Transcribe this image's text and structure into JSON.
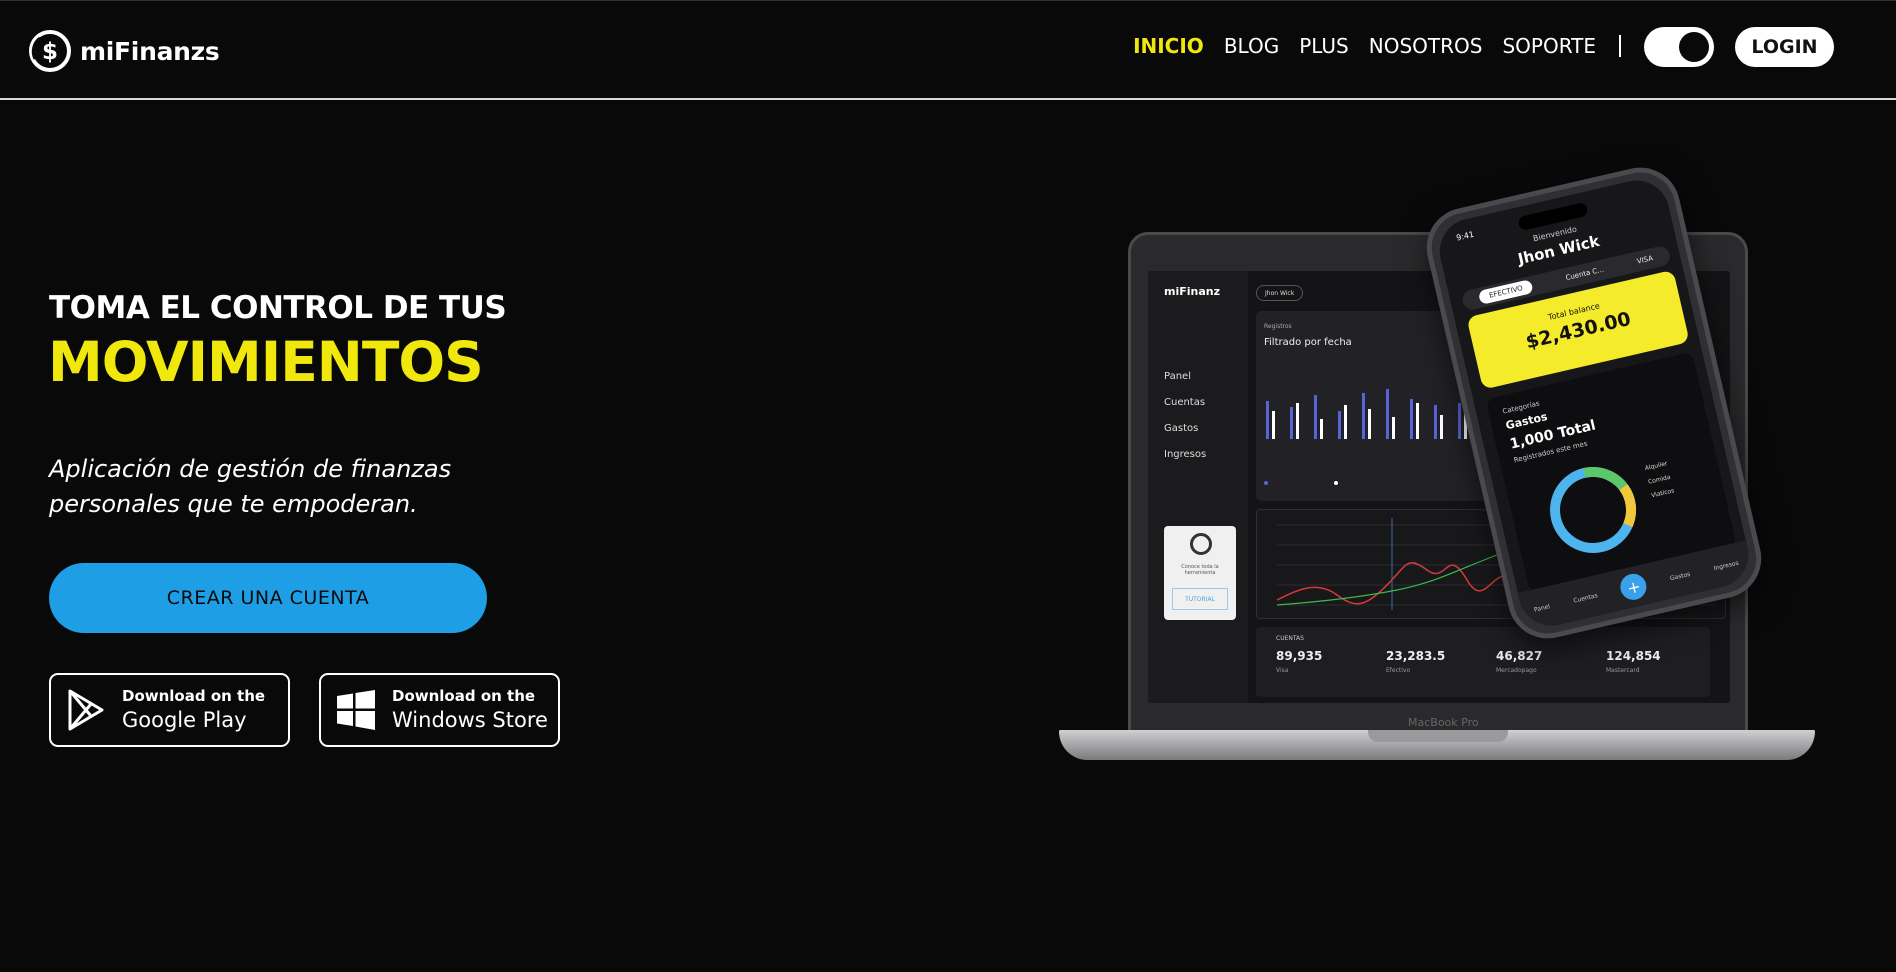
{
  "header": {
    "brand_name": "miFinanzs",
    "brand_icon": "dollar-coin-icon",
    "nav": [
      "INICIO",
      "BLOG",
      "PLUS",
      "NOSOTROS",
      "SOPORTE"
    ],
    "active_nav": "INICIO",
    "divider": "|",
    "login_label": "LOGIN",
    "theme_toggle_on": true
  },
  "hero": {
    "title_line1": "TOMA EL CONTROL DE TUS",
    "title_line2": "MOVIMIENTOS",
    "subtitle": "Aplicación de gestión de finanzas personales que te empoderan.",
    "cta_label": "CREAR UNA CUENTA",
    "stores": [
      {
        "icon": "google-play-icon",
        "small": "Download on the",
        "big": "Google Play"
      },
      {
        "icon": "windows-icon",
        "small": "Download on the",
        "big": "Windows Store"
      }
    ]
  },
  "mockup": {
    "laptop": {
      "brand": "miFinanz",
      "menu": [
        "Panel",
        "Cuentas",
        "Gastos",
        "Ingresos"
      ],
      "user": "Jhon Wick",
      "section_label": "Registros",
      "section_title": "Filtrado por fecha",
      "card_text": "Conoce toda la herramienta",
      "card_button": "TUTORIAL",
      "accounts_label": "CUENTAS",
      "accounts": [
        {
          "value": "89,935",
          "label": "Visa"
        },
        {
          "value": "23,283.5",
          "label": "Efectivo"
        },
        {
          "value": "46,827",
          "label": "Mercadopago"
        },
        {
          "value": "124,854",
          "label": "Mastercard"
        }
      ],
      "model_label": "MacBook Pro"
    },
    "phone": {
      "time": "9:41",
      "greeting": "Bienvenido",
      "user": "Jhon Wick",
      "tabs": [
        "EFECTIVO",
        "Cuenta C...",
        "VISA"
      ],
      "balance_label": "Total balance",
      "balance_value": "$2,430.00",
      "category_label": "Categorías",
      "category_title": "Gastos",
      "category_total": "1,000 Total",
      "category_sub": "Registrados este mes",
      "legend": [
        "Alquiler",
        "Comida",
        "Viaticos"
      ],
      "bottom_nav": [
        "Panel",
        "Cuentas",
        "Agregar",
        "Gastos",
        "Ingresos"
      ]
    }
  },
  "colors": {
    "background": "#0a090a",
    "accent_yellow": "#f0e80c",
    "cta_blue": "#1e9fe5",
    "text": "#ffffff"
  }
}
